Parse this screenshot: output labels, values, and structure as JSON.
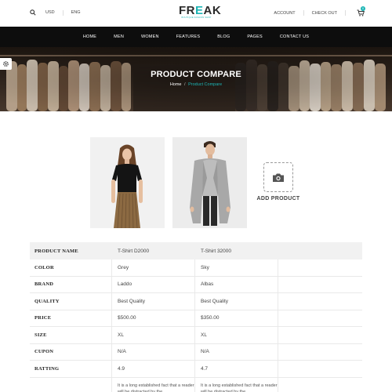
{
  "topbar": {
    "currency": "USD",
    "language": "ENG",
    "account": "ACCOUNT",
    "checkout": "CHECK OUT",
    "cart_count": "0",
    "icons": [
      "search-icon",
      "cart-icon"
    ]
  },
  "logo": {
    "word": "FREAK",
    "tagline": "BOUTIQUE FASHION SHOP"
  },
  "nav": [
    "HOME",
    "MEN",
    "WOMEN",
    "FEATURES",
    "BLOG",
    "PAGES",
    "CONTACT US"
  ],
  "hero": {
    "title": "PRODUCT COMPARE",
    "crumb_home": "Home",
    "crumb_sep": "/",
    "crumb_current": "Product Compare"
  },
  "add_product": "ADD PRODUCT",
  "table": {
    "rows": [
      {
        "label": "PRODUCT NAME",
        "a": "T-Shirt D2000",
        "b": "T-Shirt 32000"
      },
      {
        "label": "COLOR",
        "a": "Grey",
        "b": "Sky"
      },
      {
        "label": "BRAND",
        "a": "Laddo",
        "b": "Albas"
      },
      {
        "label": "QUALITY",
        "a": "Best Quality",
        "b": "Best Quality"
      },
      {
        "label": "PRICE",
        "a": "$500.00",
        "b": "$350.00"
      },
      {
        "label": "SIZE",
        "a": "XL",
        "b": "XL"
      },
      {
        "label": "CUPON",
        "a": "N/A",
        "b": "N/A"
      },
      {
        "label": "RATTING",
        "a": "4.9",
        "b": "4.7"
      }
    ],
    "description": {
      "a": "It is a long established fact that a reader will be distracted by the",
      "b": "It is a long established fact that a reader will be distracted by the"
    }
  },
  "colors": {
    "accent": "#1cb5b5",
    "nav_bg": "#0d0d0d",
    "table_head_bg": "#f1f1f1"
  }
}
